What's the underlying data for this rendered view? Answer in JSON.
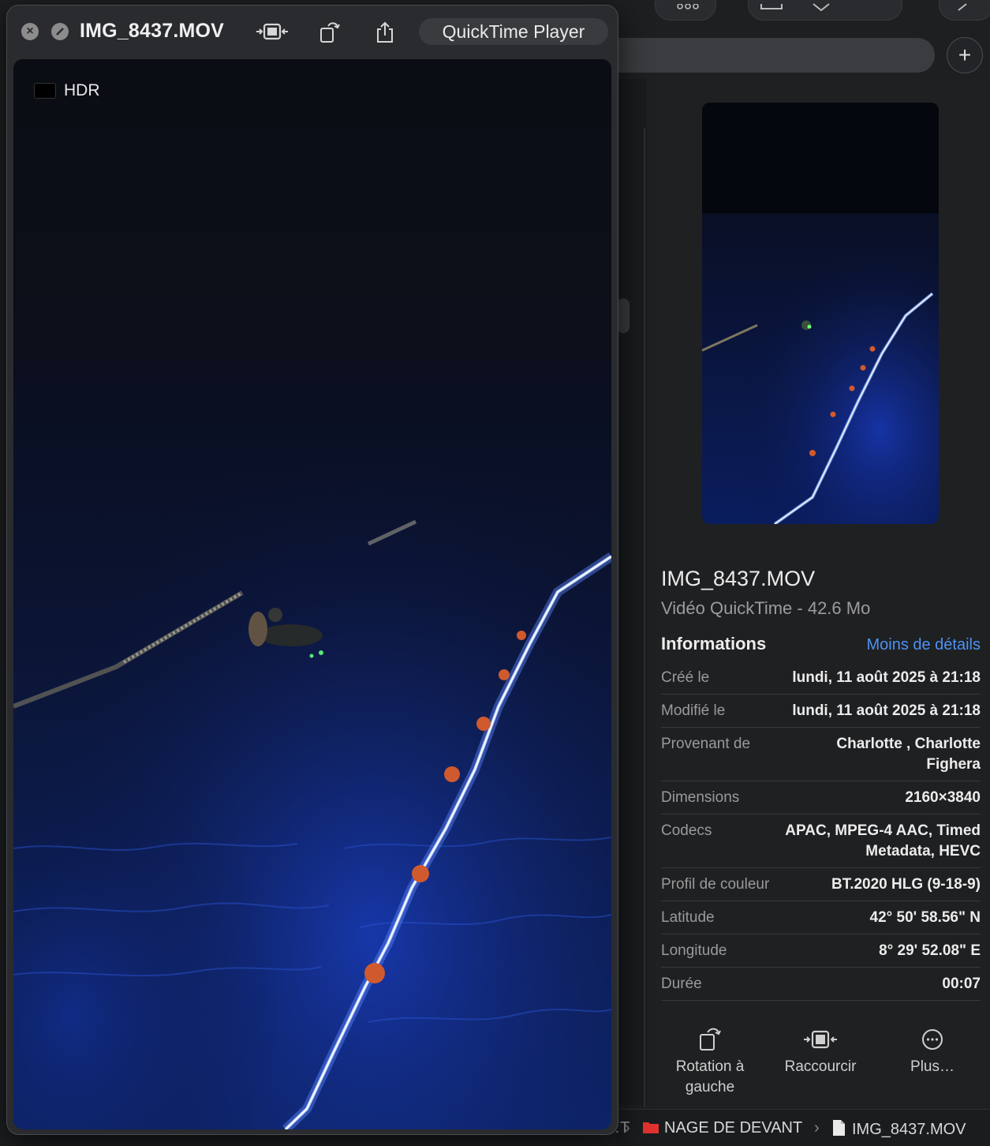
{
  "quicktime": {
    "title": "IMG_8437.MOV",
    "app_name": "QuickTime Player",
    "hdr_label": "HDR",
    "icons": [
      "close-icon",
      "minimize-icon",
      "trim-icon",
      "rotate-icon",
      "share-icon"
    ]
  },
  "inspector": {
    "file_name": "IMG_8437.MOV",
    "file_kind": "Vidéo QuickTime - 42.6 Mo",
    "info_heading": "Informations",
    "less_details": "Moins de détails",
    "rows": [
      {
        "key": "Créé le",
        "value": "lundi, 11 août 2025 à 21:18"
      },
      {
        "key": "Modifié le",
        "value": "lundi, 11 août 2025 à 21:18"
      },
      {
        "key": "Provenant de",
        "value": "Charlotte , Charlotte Fighera"
      },
      {
        "key": "Dimensions",
        "value": "2160×3840"
      },
      {
        "key": "Codecs",
        "value": "APAC, MPEG-4 AAC, Timed Metadata, HEVC"
      },
      {
        "key": "Profil de couleur",
        "value": "BT.2020 HLG (9-18-9)"
      },
      {
        "key": "Latitude",
        "value": "42° 50' 58.56\" N"
      },
      {
        "key": "Longitude",
        "value": "8° 29' 52.08\" E"
      },
      {
        "key": "Durée",
        "value": "00:07"
      }
    ],
    "actions": [
      {
        "label": "Rotation à gauche",
        "icon": "rotate-left-icon"
      },
      {
        "label": "Raccourcir",
        "icon": "trim-icon"
      },
      {
        "label": "Plus…",
        "icon": "more-icon"
      }
    ]
  },
  "pathbar": {
    "truncated": "…T",
    "folder": "NAGE DE DEVANT",
    "file": "IMG_8437.MOV",
    "folder_color": "#e0322f"
  },
  "finder": {
    "add_label": "+"
  }
}
